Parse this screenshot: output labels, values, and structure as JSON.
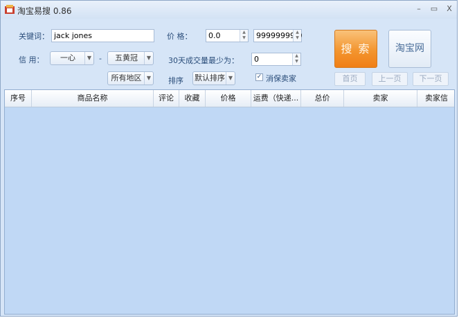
{
  "window": {
    "title": "淘宝易搜 0.86",
    "controls": {
      "minimize": "–",
      "maximize": "▭",
      "close": "X"
    }
  },
  "search": {
    "keyword_label": "关键词：",
    "keyword_value": "jack jones",
    "credit_label": "信 用：",
    "credit_from": "一心",
    "credit_dash": "-",
    "credit_to": "五黄冠",
    "region": "所有地区",
    "price_label": "价 格：",
    "price_min": "0.0",
    "price_max": "99999999.0",
    "min_sales_label": "30天成交量最少为：",
    "min_sales_value": "0",
    "sort_label": "排序",
    "sort_value": "默认排序",
    "consumer_protection_label": "消保卖家",
    "consumer_protection_checked": true,
    "search_button": "搜 索",
    "taobao_button": "淘宝网"
  },
  "pagination": {
    "first": "首页",
    "prev": "上一页",
    "next": "下一页"
  },
  "table": {
    "columns": [
      "序号",
      "商品名称",
      "评论",
      "收藏",
      "价格",
      "运费（快递...",
      "总价",
      "卖家",
      "卖家信"
    ],
    "rows": []
  },
  "colors": {
    "window_bg": "#d6e5f7",
    "grid_bg": "#c0d8f5",
    "search_button": "#f3952f"
  }
}
